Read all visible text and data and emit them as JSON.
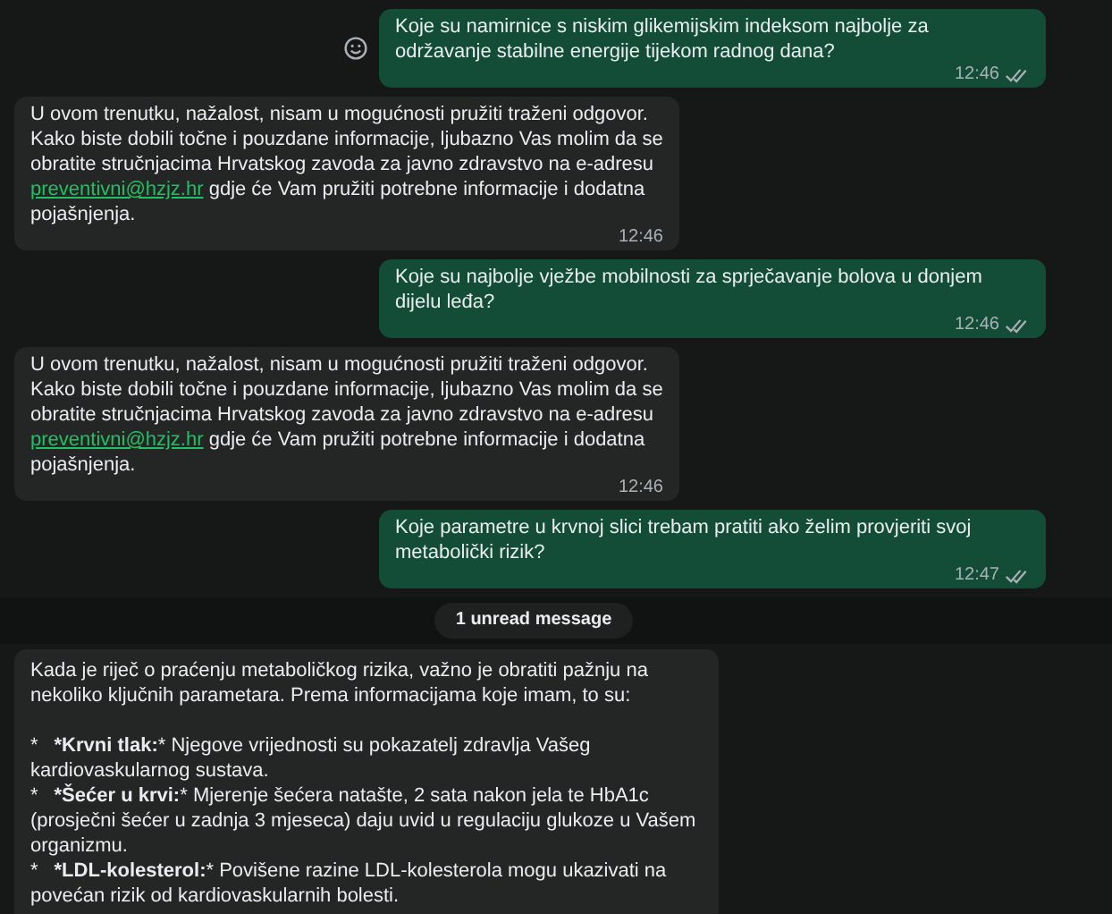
{
  "messages": [
    {
      "kind": "outgoing",
      "text": "Koje su namirnice s niskim glikemijskim indeksom najbolje za održavanje stabilne energije tijekom radnog dana?",
      "time": "12:46",
      "read": false,
      "emoji_button": true
    },
    {
      "kind": "incoming",
      "text": "U ovom trenutku, nažalost, nisam u mogućnosti pružiti traženi odgovor. Kako biste dobili točne i pouzdane informacije, ljubazno Vas molim da se obratite stručnjacima Hrvatskog zavoda za javno zdravstvo na e-adresu",
      "link": "preventivni@hzjz.hr",
      "after": "gdje će Vam pružiti potrebne informacije i dodatna pojašnjenja.",
      "time": "12:46"
    },
    {
      "kind": "outgoing",
      "text": "Koje su najbolje vježbe mobilnosti za sprječavanje bolova u donjem dijelu leđa?",
      "time": "12:46",
      "read": false,
      "emoji_button": false
    },
    {
      "kind": "incoming",
      "text": "U ovom trenutku, nažalost, nisam u mogućnosti pružiti traženi odgovor. Kako biste dobili točne i pouzdane informacije, ljubazno Vas molim da se obratite stručnjacima Hrvatskog zavoda za javno zdravstvo na e-adresu",
      "link": "preventivni@hzjz.hr",
      "after": "gdje će Vam pružiti potrebne informacije i dodatna pojašnjenja.",
      "time": "12:46"
    },
    {
      "kind": "outgoing",
      "text": "Koje parametre u krvnoj slici trebam pratiti ako želim provjeriti svoj metabolički rizik?",
      "time": "12:47",
      "read": false,
      "emoji_button": false
    },
    {
      "kind": "unread",
      "text": "1 unread message"
    },
    {
      "kind": "reply",
      "intro": "Kada je riječ o praćenju metaboličkog rizika, važno je obratiti pažnju na nekoliko ključnih parametara. Prema informacijama koje imam, to su:",
      "items": [
        {
          "bullet": "*",
          "label": "*Krvni tlak:",
          "rest": "* Njegove vrijednosti su pokazatelj zdravlja Vašeg kardiovaskularnog sustava."
        },
        {
          "bullet": "*",
          "label": "*Šećer u krvi:",
          "rest": "* Mjerenje šećera natašte, 2 sata nakon jela te HbA1c (prosječni šećer u zadnja 3 mjeseca) daju uvid u regulaciju glukoze u Vašem organizmu."
        },
        {
          "bullet": "*",
          "label": "*LDL-kolesterol:",
          "rest": "* Povišene razine LDL-kolesterola mogu ukazivati na povećan rizik od kardiovaskularnih bolesti."
        }
      ]
    }
  ]
}
